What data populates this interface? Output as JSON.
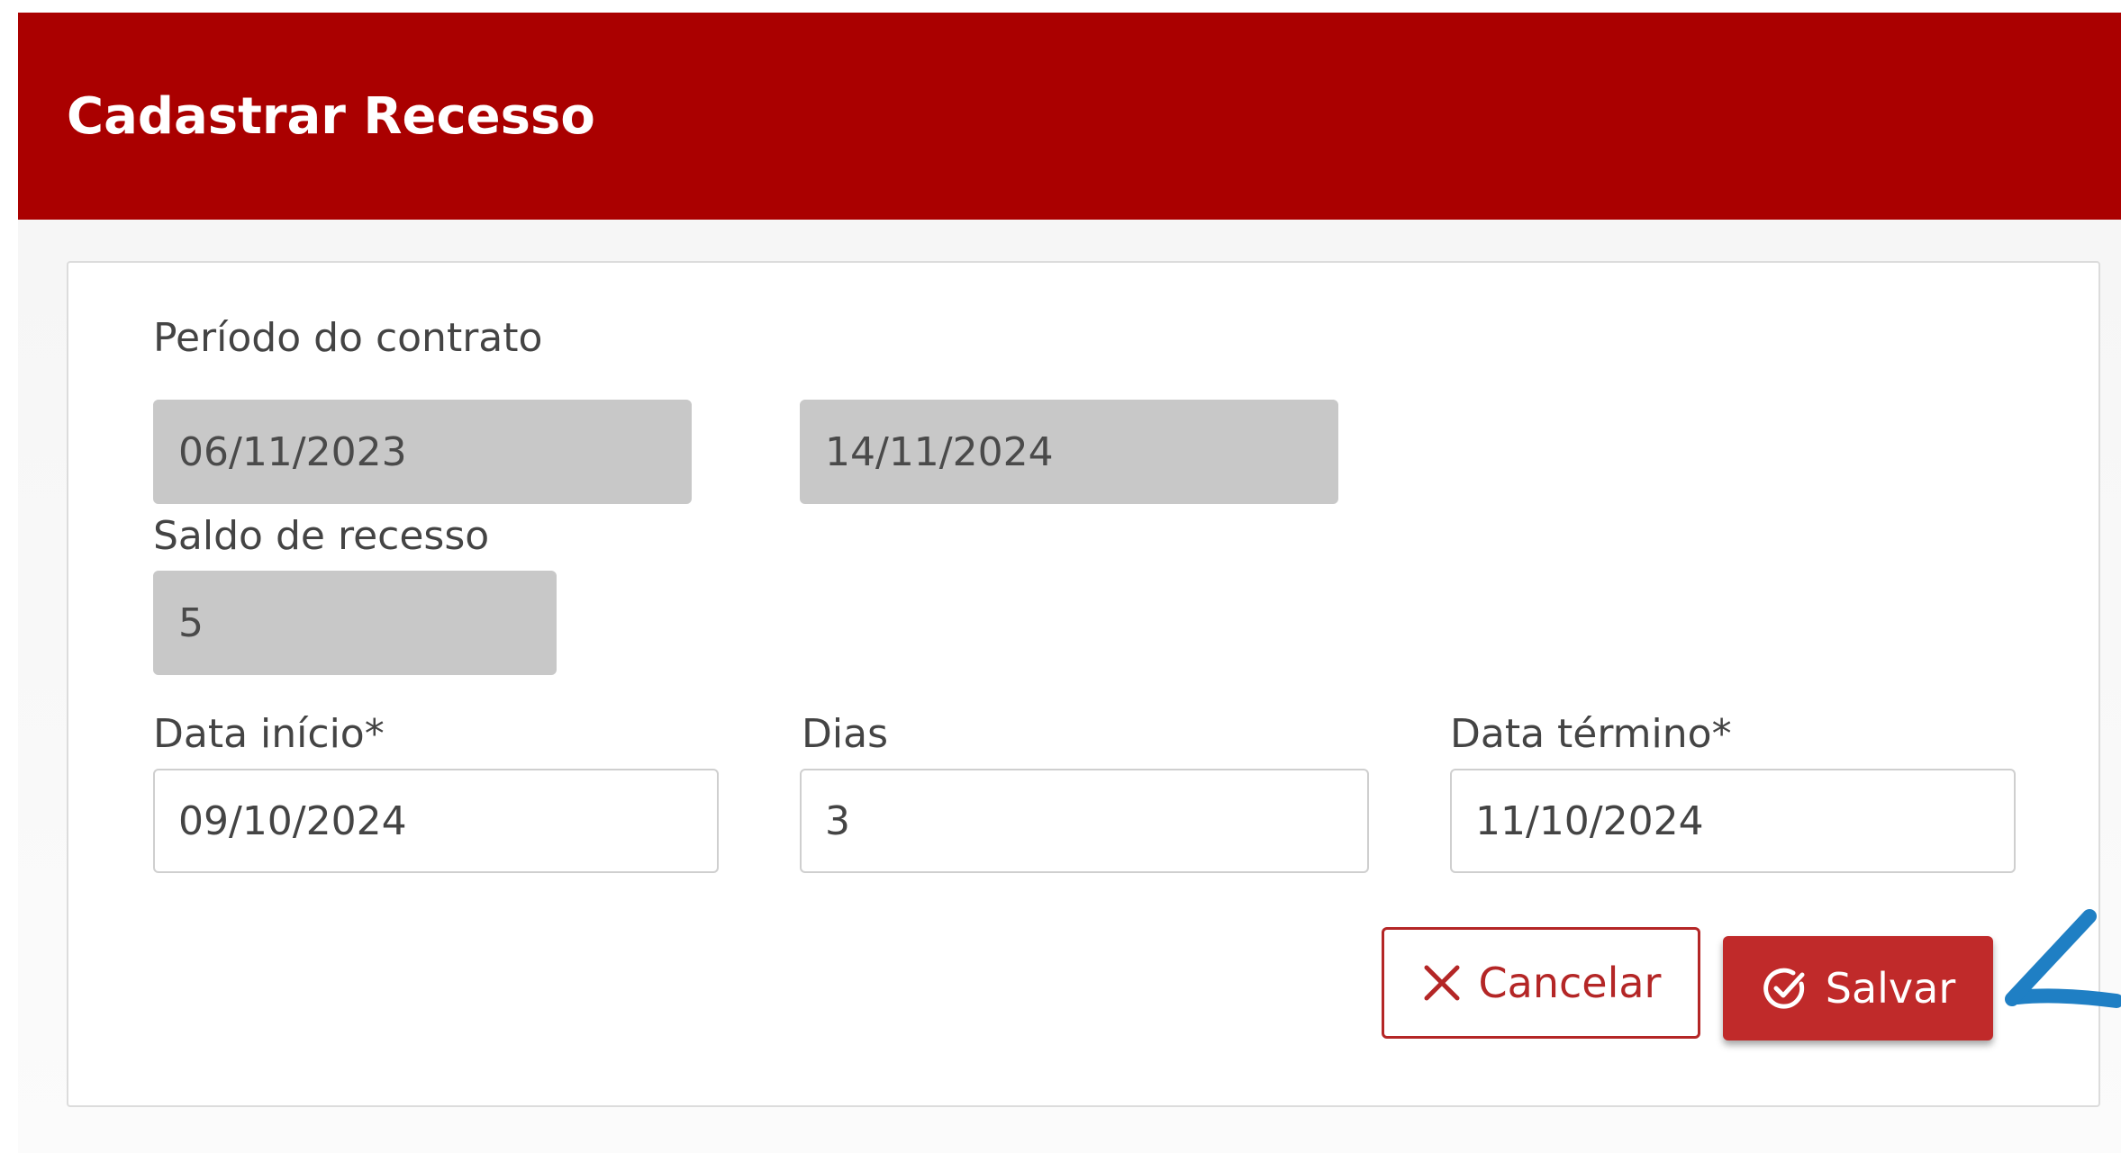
{
  "header": {
    "title": "Cadastrar Recesso"
  },
  "form": {
    "contract_period": {
      "label": "Período do contrato",
      "start": "06/11/2023",
      "end": "14/11/2024"
    },
    "recess_balance": {
      "label": "Saldo de recesso",
      "value": "5"
    },
    "start_date": {
      "label": "Data início*",
      "value": "09/10/2024"
    },
    "days": {
      "label": "Dias",
      "value": "3"
    },
    "end_date": {
      "label": "Data término*",
      "value": "11/10/2024"
    }
  },
  "actions": {
    "cancel_label": "Cancelar",
    "save_label": "Salvar"
  },
  "colors": {
    "header_bg": "#aa0000",
    "primary": "#c02a2a",
    "readonly_bg": "#c8c8c8",
    "annotation_arrow": "#1f7fc4"
  },
  "icons": {
    "cancel": "close-icon",
    "save": "check-circle-icon",
    "annotation": "arrow-pointer-icon"
  }
}
